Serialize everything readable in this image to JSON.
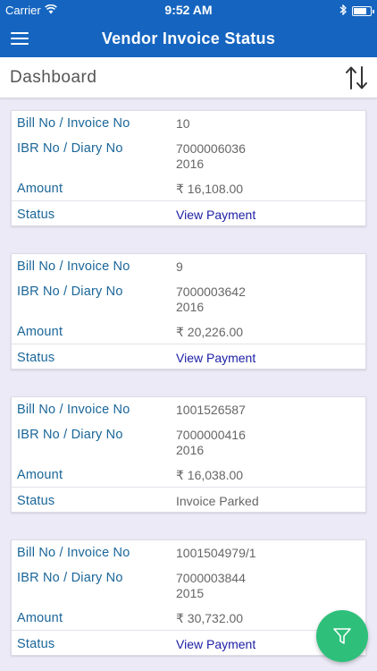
{
  "status_bar": {
    "carrier": "Carrier",
    "time": "9:52 AM",
    "wifi_icon": "wifi-icon",
    "bluetooth_icon": "bluetooth-icon",
    "battery_level": 0.85
  },
  "header": {
    "title": "Vendor Invoice Status",
    "menu_icon": "hamburger-menu-icon",
    "color": "#1565c0"
  },
  "subheader": {
    "label": "Dashboard",
    "sort_icon": "sort-up-down-icon"
  },
  "labels": {
    "bill": "Bill No / Invoice No",
    "ibr": "IBR No / Diary No",
    "amount": "Amount",
    "status": "Status"
  },
  "cards": [
    {
      "bill_no": "10",
      "ibr_no": "7000006036",
      "diary_no": "2016",
      "amount": "₹ 16,108.00",
      "status": "View Payment",
      "status_link": true
    },
    {
      "bill_no": "9",
      "ibr_no": "7000003642",
      "diary_no": "2016",
      "amount": "₹ 20,226.00",
      "status": "View Payment",
      "status_link": true
    },
    {
      "bill_no": "1001526587",
      "ibr_no": "7000000416",
      "diary_no": "2016",
      "amount": "₹ 16,038.00",
      "status": "Invoice Parked",
      "status_link": false
    },
    {
      "bill_no": "1001504979/1",
      "ibr_no": "7000003844",
      "diary_no": "2015",
      "amount": "₹ 30,732.00",
      "status": "View Payment",
      "status_link": true
    }
  ],
  "fab": {
    "icon": "filter-icon",
    "color": "#2ec07b"
  }
}
